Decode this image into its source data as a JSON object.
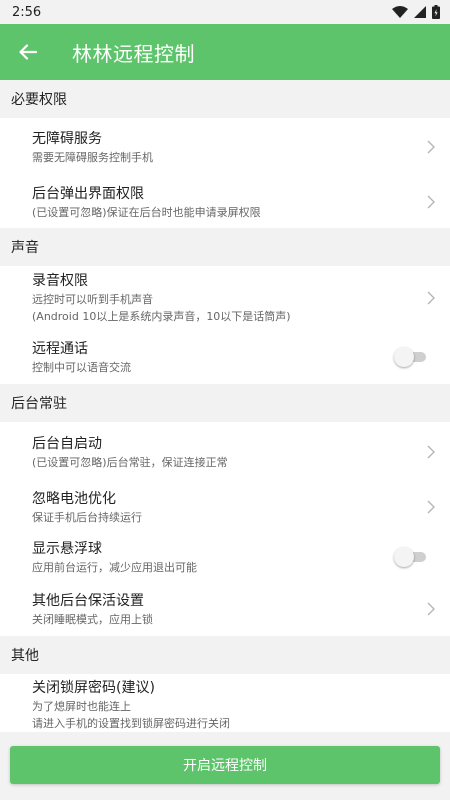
{
  "status_bar": {
    "time": "2:56"
  },
  "app_bar": {
    "title": "林林远程控制",
    "back_icon": "arrow-back-icon"
  },
  "colors": {
    "accent": "#5ec46b",
    "background": "#f2f2f2"
  },
  "sections": [
    {
      "header": "必要权限",
      "items": [
        {
          "title": "无障碍服务",
          "desc": "需要无障碍服务控制手机",
          "control": "chevron"
        },
        {
          "title": "后台弹出界面权限",
          "desc": "(已设置可忽略)保证在后台时也能申请录屏权限",
          "control": "chevron"
        }
      ]
    },
    {
      "header": "声音",
      "items": [
        {
          "title": "录音权限",
          "desc": "远控时可以听到手机声音",
          "desc2": "(Android 10以上是系统内录声音，10以下是话筒声)",
          "control": "chevron"
        },
        {
          "title": "远程通话",
          "desc": "控制中可以语音交流",
          "control": "toggle",
          "toggle_on": false
        }
      ]
    },
    {
      "header": "后台常驻",
      "items": [
        {
          "title": "后台自启动",
          "desc": "(已设置可忽略)后台常驻，保证连接正常",
          "control": "chevron"
        },
        {
          "title": "忽略电池优化",
          "desc": "保证手机后台持续运行",
          "control": "chevron"
        },
        {
          "title": "显示悬浮球",
          "desc": "应用前台运行，减少应用退出可能",
          "control": "toggle",
          "toggle_on": false
        },
        {
          "title": "其他后台保活设置",
          "desc": "关闭睡眠模式，应用上锁",
          "control": "chevron"
        }
      ]
    },
    {
      "header": "其他",
      "items": [
        {
          "title": "关闭锁屏密码(建议)",
          "desc": "为了熄屏时也能连上",
          "desc2": "请进入手机的设置找到锁屏密码进行关闭",
          "control": "none"
        }
      ]
    }
  ],
  "bottom_button": {
    "label": "开启远程控制"
  }
}
